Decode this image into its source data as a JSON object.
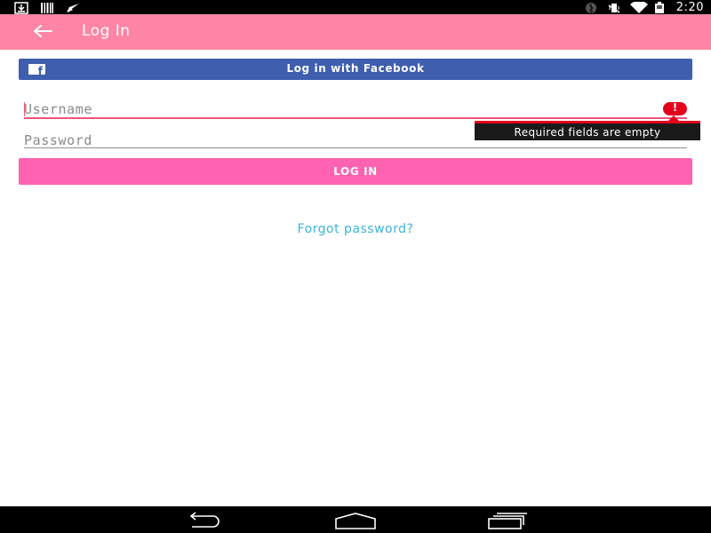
{
  "toolbar": {
    "title": "Log In",
    "back_icon": "arrow-left-icon"
  },
  "status_bar": {
    "time": "2:20",
    "left_icons": [
      "download-notification-icon",
      "barcode-notification-icon",
      "send-notification-icon"
    ],
    "right_icons": [
      "bluetooth-icon",
      "vibrate-icon",
      "wifi-icon",
      "battery-icon"
    ]
  },
  "facebook_button": {
    "label": "Log in with Facebook",
    "icon": "facebook-icon",
    "color": "#3f5eae"
  },
  "username": {
    "placeholder": "Username",
    "value": ""
  },
  "password": {
    "placeholder": "Password",
    "value": ""
  },
  "error": {
    "message": "Required fields are empty",
    "icon_glyph": "!",
    "color": "#e3001b"
  },
  "login_button": {
    "label": "LOG IN",
    "color": "#ff62b0"
  },
  "forgot_password": {
    "label": "Forgot password?",
    "color": "#3db4dd"
  },
  "nav_bar": {
    "icons": [
      "back-nav-icon",
      "home-nav-icon",
      "recents-nav-icon"
    ]
  },
  "colors": {
    "toolbar": "#ff85a5",
    "input_focus": "#ee5577"
  }
}
